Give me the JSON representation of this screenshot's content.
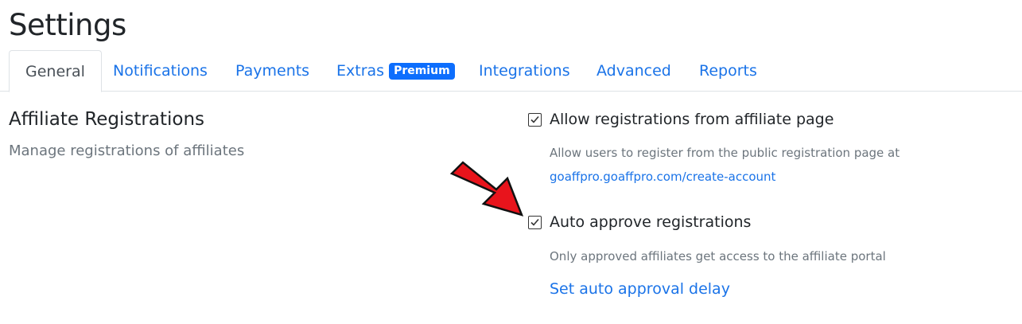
{
  "page": {
    "title": "Settings"
  },
  "tabs": [
    {
      "label": "General",
      "active": true
    },
    {
      "label": "Notifications"
    },
    {
      "label": "Payments"
    },
    {
      "label": "Extras",
      "badge": "Premium"
    },
    {
      "label": "Integrations"
    },
    {
      "label": "Advanced"
    },
    {
      "label": "Reports"
    }
  ],
  "section": {
    "title": "Affiliate Registrations",
    "subtitle": "Manage registrations of affiliates"
  },
  "options": [
    {
      "label": "Allow registrations from affiliate page",
      "checked": true,
      "help": "Allow users to register from the public registration page at",
      "link": "goaffpro.goaffpro.com/create-account"
    },
    {
      "label": "Auto approve registrations",
      "checked": true,
      "help": "Only approved affiliates get access to the affiliate portal",
      "link": "Set auto approval delay"
    }
  ],
  "colors": {
    "link": "#1a73e8",
    "badge": "#0d6efd",
    "arrow": "#e8141c"
  }
}
